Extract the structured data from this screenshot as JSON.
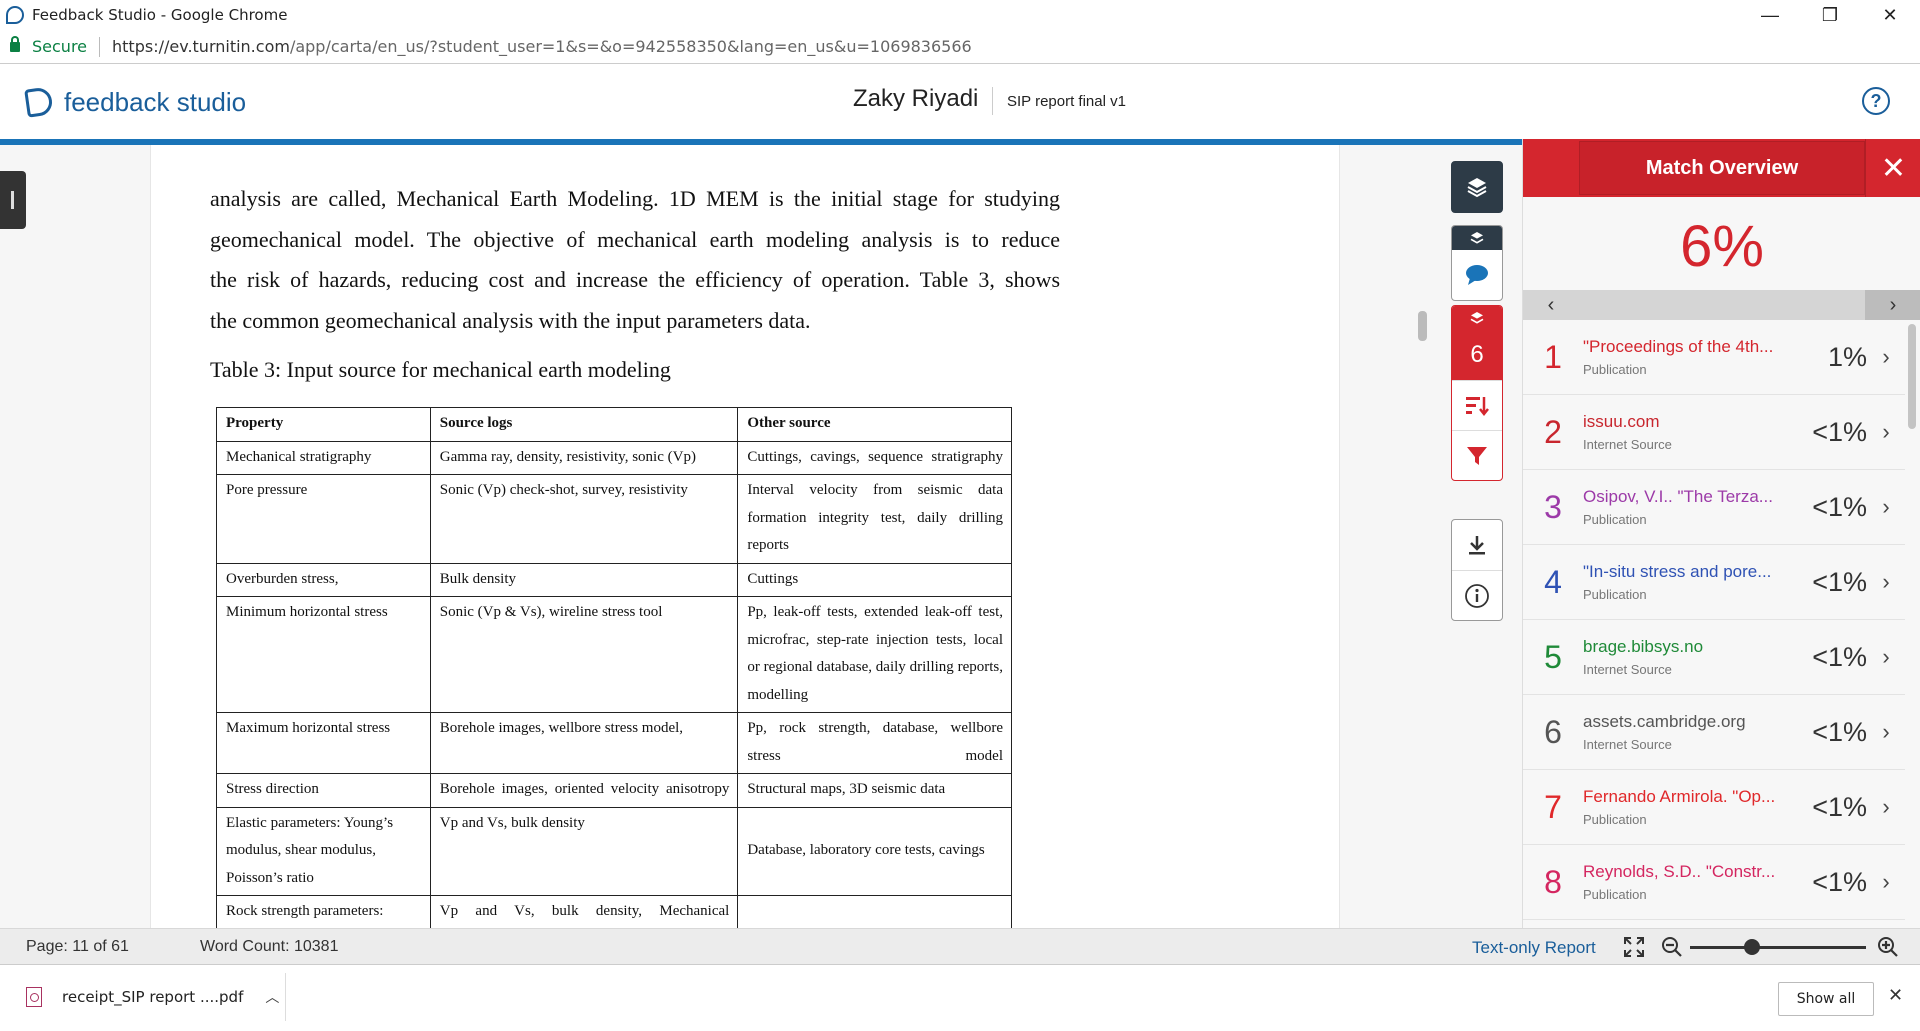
{
  "window": {
    "title": "Feedback Studio - Google Chrome"
  },
  "addressbar": {
    "secure_label": "Secure",
    "url_main": "https://ev.turnitin.com",
    "url_rest": "/app/carta/en_us/?student_user=1&s=&o=942558350&lang=en_us&u=1069836566"
  },
  "header": {
    "logo_text": "feedback studio",
    "student_name": "Zaky Riyadi",
    "document_title": "SIP report final v1",
    "help_label": "?"
  },
  "document": {
    "lines": [
      "analysis are called, Mechanical Earth Modeling. 1D MEM is the initial stage for studying",
      "geomechanical model. The objective of mechanical earth modeling analysis is to reduce",
      "the risk of hazards, reducing cost and increase the efficiency of operation. Table 3, shows",
      "the common geomechanical analysis with the input parameters data."
    ],
    "table_caption": "Table 3: Input source for mechanical earth modeling",
    "table": {
      "headers": [
        "Property",
        "Source logs",
        "Other source"
      ],
      "rows": [
        [
          "Mechanical stratigraphy",
          "Gamma ray, density, resistivity, sonic (Vp)",
          "Cuttings, cavings, sequence stratigraphy"
        ],
        [
          "Pore pressure",
          "Sonic (Vp) check-shot, survey, resistivity",
          "Interval velocity from seismic data formation integrity test, daily drilling reports"
        ],
        [
          "Overburden stress,",
          "Bulk density",
          "Cuttings"
        ],
        [
          "Minimum horizontal stress",
          "Sonic (Vp & Vs), wireline stress tool",
          "Pp, leak-off tests, extended leak-off test, microfrac, step-rate injection tests, local or regional database, daily drilling reports, modelling"
        ],
        [
          "Maximum horizontal stress",
          "Borehole images, wellbore stress model,",
          "Pp, rock strength, database, wellbore stress model"
        ],
        [
          "Stress direction",
          "Borehole images, oriented velocity anisotropy",
          "Structural maps, 3D seismic data"
        ],
        [
          "Elastic parameters: Young’s modulus, shear modulus, Poisson’s ratio",
          "Vp and Vs, bulk density",
          "Database, laboratory core tests, cavings"
        ],
        [
          "Rock strength parameters:",
          "Vp and Vs, bulk density, Mechanical",
          ""
        ]
      ]
    }
  },
  "rail": {
    "similarity_count": "6"
  },
  "panel": {
    "title": "Match Overview",
    "close_label": "✕",
    "overall_percent": "6%",
    "prev_label": "‹",
    "next_label": "›",
    "matches": [
      {
        "num": "1",
        "title": "\"Proceedings of the 4th...",
        "type": "Publication",
        "percent": "1%",
        "color": "#d4262e"
      },
      {
        "num": "2",
        "title": "issuu.com",
        "type": "Internet Source",
        "percent": "<1%",
        "color": "#c8262e"
      },
      {
        "num": "3",
        "title": "Osipov, V.I.. \"The Terza...",
        "type": "Publication",
        "percent": "<1%",
        "color": "#9c3aa8"
      },
      {
        "num": "4",
        "title": "\"In-situ stress and pore...",
        "type": "Publication",
        "percent": "<1%",
        "color": "#2f52b4"
      },
      {
        "num": "5",
        "title": "brage.bibsys.no",
        "type": "Internet Source",
        "percent": "<1%",
        "color": "#1f8a38"
      },
      {
        "num": "6",
        "title": "assets.cambridge.org",
        "type": "Internet Source",
        "percent": "<1%",
        "color": "#555555"
      },
      {
        "num": "7",
        "title": "Fernando Armirola. \"Op...",
        "type": "Publication",
        "percent": "<1%",
        "color": "#e0282a"
      },
      {
        "num": "8",
        "title": "Reynolds, S.D.. \"Constr...",
        "type": "Publication",
        "percent": "<1%",
        "color": "#d42660"
      }
    ]
  },
  "statusbar": {
    "page": "Page: 11 of 61",
    "word_count": "Word Count: 10381",
    "text_only": "Text-only Report"
  },
  "downloads": {
    "file_name": "receipt_SIP report ....pdf",
    "show_all": "Show all",
    "close_label": "✕"
  }
}
